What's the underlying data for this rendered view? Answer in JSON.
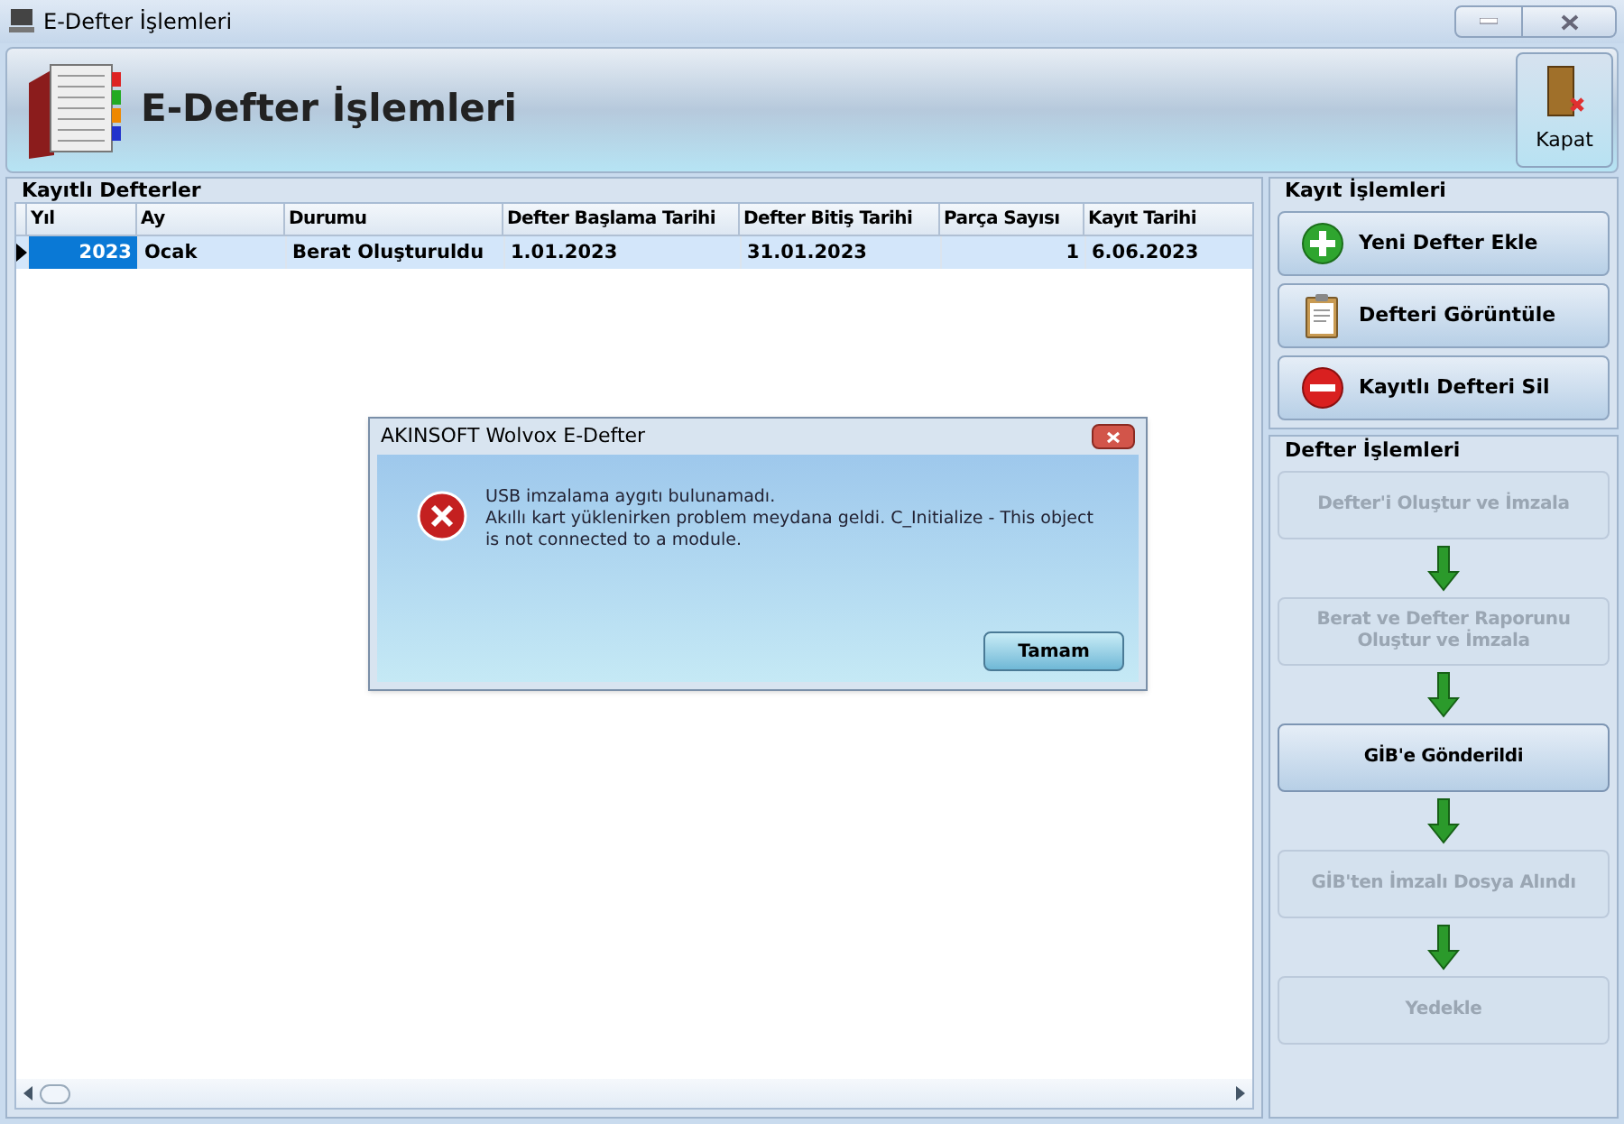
{
  "window": {
    "title": "E-Defter İşlemleri"
  },
  "header": {
    "title": "E-Defter İşlemleri",
    "close_button": "Kapat"
  },
  "records": {
    "title": "Kayıtlı Defterler",
    "columns": [
      "Yıl",
      "Ay",
      "Durumu",
      "Defter Başlama Tarihi",
      "Defter Bitiş Tarihi",
      "Parça Sayısı",
      "Kayıt Tarihi"
    ],
    "rows": [
      {
        "selected": true,
        "cells": [
          "2023",
          "Ocak",
          "Berat Oluşturuldu",
          "1.01.2023",
          "31.01.2023",
          "1",
          "6.06.2023"
        ]
      }
    ]
  },
  "record_actions": {
    "title": "Kayıt İşlemleri",
    "buttons": [
      {
        "label": "Yeni Defter Ekle",
        "kind": "add"
      },
      {
        "label": "Defteri Görüntüle",
        "kind": "view"
      },
      {
        "label": "Kayıtlı Defteri Sil",
        "kind": "delete"
      }
    ]
  },
  "ledger_actions": {
    "title": "Defter İşlemleri",
    "steps": [
      {
        "label": "Defter'i Oluştur ve İmzala",
        "disabled": true
      },
      {
        "label": "Berat ve Defter Raporunu Oluştur ve İmzala",
        "disabled": true
      },
      {
        "label": "GİB'e Gönderildi",
        "disabled": false
      },
      {
        "label": "GİB'ten İmzalı Dosya Alındı",
        "disabled": true
      },
      {
        "label": "Yedekle",
        "disabled": true
      }
    ]
  },
  "dialog": {
    "title": "AKINSOFT Wolvox E-Defter",
    "message_lines": [
      "USB imzalama aygıtı bulunamadı.",
      "Akıllı kart yüklenirken problem meydana geldi. C_Initialize - This object is not connected to a module."
    ],
    "button": "Tamam"
  }
}
